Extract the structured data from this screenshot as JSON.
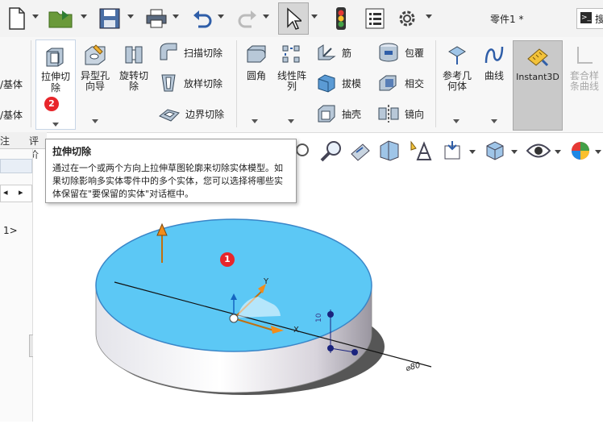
{
  "titlebar": {
    "document_title": "零件1 *",
    "search_partial": "搜"
  },
  "left_cut_labels": [
    "/基体",
    "/基体"
  ],
  "ribbon": {
    "extrude_cut": "拉伸切除",
    "hole_wizard": "异型孔向导",
    "revolve_cut": "旋转切除",
    "swept_cut": "扫描切除",
    "loft_cut": "放样切除",
    "boundary_cut": "边界切除",
    "fillet": "圆角",
    "linear_pattern": "线性阵列",
    "rib": "筋",
    "draft": "拔模",
    "shell": "抽壳",
    "wrap": "包覆",
    "intersect": "相交",
    "mirror": "镜向",
    "reference_geometry": "参考几何体",
    "curves": "曲线",
    "instant3d": "Instant3D",
    "spline_on_surface": "套合样条曲线"
  },
  "tabs": [
    "注",
    "评价"
  ],
  "tree": {
    "arrow_left": "◂",
    "arrow_right": "▸",
    "item": "1>"
  },
  "tooltip": {
    "title": "拉伸切除",
    "body": "通过在一个或两个方向上拉伸草图轮廓来切除实体模型。如果切除影响多实体零件中的多个实体，您可以选择将哪些实体保留在\"要保留的实体\"对话框中。"
  },
  "badges": {
    "callout_1": "1",
    "callout_2": "2"
  },
  "model": {
    "axis_x": "X",
    "axis_y": "Y",
    "dim_height": "10",
    "dim_diameter": "⌀80"
  },
  "colors": {
    "face_selected": "#5cc8f5",
    "accent_red": "#e8262b",
    "instant3d_bg": "#c9c9c9"
  }
}
